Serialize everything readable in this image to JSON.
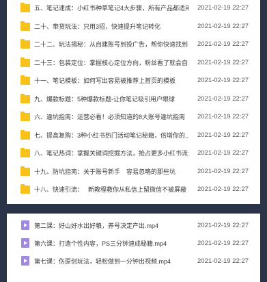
{
  "folders": [
    {
      "name": "五、笔记速成：小红书种草笔记4大步骤，所有产品都适用",
      "date": "2021-02-19 22:27"
    },
    {
      "name": "二十、带货玩法：只用3招，快速提升笔记转化",
      "date": "2021-02-19 22:27"
    },
    {
      "name": "二十二、玩法揭秘：从自建账号到投广告，帮你快速找到...",
      "date": "2021-02-19 22:27"
    },
    {
      "name": "二十三：包装定位：掌握核心定位方向，粉丝看了就会自...",
      "date": "2021-02-19 22:27"
    },
    {
      "name": "十一、笔记模板：如何写出容易被推荐上首页的模板",
      "date": "2021-02-19 22:27"
    },
    {
      "name": "九、爆款标题：5种爆款标题-让你笔记吸引用户眼球",
      "date": "2021-02-19 22:27"
    },
    {
      "name": "六、違坑指南：运营必看！必须知道的8大账号違坑指南",
      "date": "2021-02-19 22:27"
    },
    {
      "name": "七、提高复购：3种小红书热门活动笔记秘籍，倍增你的...",
      "date": "2021-02-19 22:27"
    },
    {
      "name": "八、笔记热词：掌握关键词挖掘方法，抢占更多小红书流量",
      "date": "2021-02-19 22:27"
    },
    {
      "name": "十九、防坑指南：关于账号新手　容易忽略的那些坑",
      "date": "2021-02-19 22:27"
    },
    {
      "name": "十八、快速引流：　 新教程教你从私信上留微信不被屏蔽",
      "date": "2021-02-19 22:27"
    }
  ],
  "videos": [
    {
      "name": "第二课：好山好水出好粮，养号决定产出.mp4",
      "date": "2021-02-19 22:27"
    },
    {
      "name": "第六课：打造个性内容，PS三分钟速成秘籍.mp4",
      "date": "2021-02-19 22:27"
    },
    {
      "name": "第七课：伤原创玩法，轻松做到一分钟出视频.mp4",
      "date": "2021-02-19 22:27"
    }
  ],
  "icons": {
    "folder": "folder-icon",
    "video": "video-file-icon"
  },
  "colors": {
    "background": "#2b3348",
    "panel": "#ffffff",
    "folder": "#f7c21b",
    "video": "#9f8ae0"
  }
}
